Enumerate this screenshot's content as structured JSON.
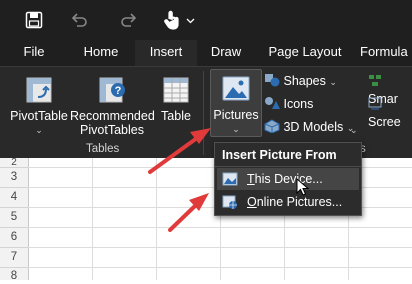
{
  "tabs": [
    "File",
    "Home",
    "Insert",
    "Draw",
    "Page Layout",
    "Formula"
  ],
  "ribbon": {
    "pivottable": "PivotTable",
    "recommended_line1": "Recommended",
    "recommended_line2": "PivotTables",
    "table": "Table",
    "pictures": "Pictures",
    "shapes": "Shapes",
    "icons": "Icons",
    "models": "3D Models",
    "smartart": "Smar",
    "screenshot": "Scree",
    "group_tables": "Tables",
    "group_s": "s"
  },
  "menu": {
    "title": "Insert Picture From",
    "this_device_u": "T",
    "this_device_rest": "his Device...",
    "online_u": "O",
    "online_rest": "nline Pictures..."
  },
  "rows": [
    "2",
    "3",
    "4",
    "5",
    "6",
    "7",
    "8"
  ],
  "colors": {
    "accent": "#3a8f45",
    "arrow": "#e03a3a"
  }
}
